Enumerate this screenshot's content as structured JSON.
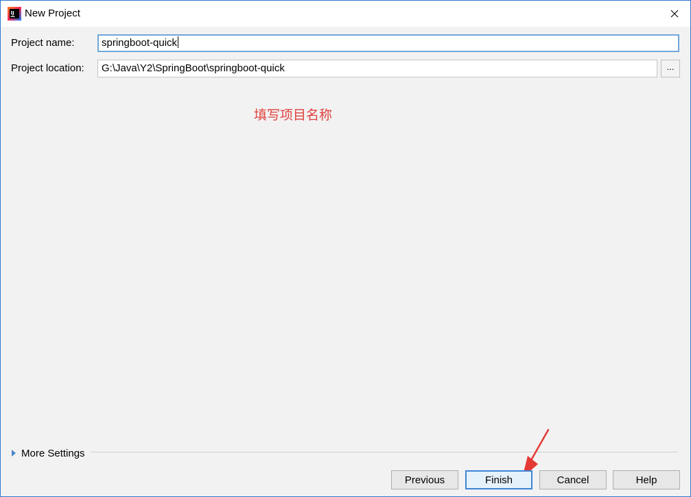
{
  "window": {
    "title": "New Project",
    "close_glyph": "✕",
    "app_icon": "intellij-idea-icon",
    "app_icon_text": "IJ"
  },
  "form": {
    "name_label": "Project name:",
    "name_value": "springboot-quick",
    "location_label": "Project location:",
    "location_value": "G:\\Java\\Y2\\SpringBoot\\springboot-quick",
    "browse_label": "..."
  },
  "annotation": {
    "text": "填写项目名称",
    "color": "#e0413e"
  },
  "more_settings": {
    "label": "More Settings",
    "icon": "expand-triangle-icon"
  },
  "buttons": {
    "previous": "Previous",
    "finish": "Finish",
    "cancel": "Cancel",
    "help": "Help"
  },
  "colors": {
    "accent": "#3d84d6",
    "annotation_red": "#e0413e",
    "dialog_bg": "#f2f2f2"
  }
}
